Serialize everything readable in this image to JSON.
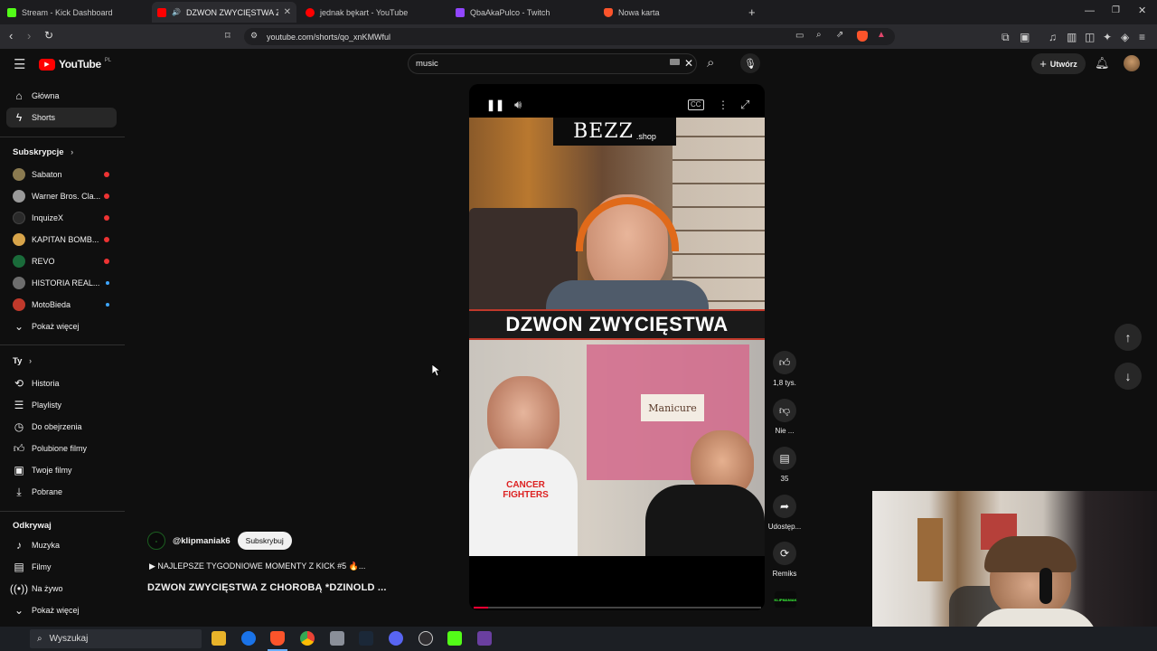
{
  "browser": {
    "tabs": [
      {
        "title": "Stream - Kick Dashboard",
        "icon": "kick-icon",
        "color": "#53fc18"
      },
      {
        "title": "DZWON ZWYCIĘSTWA Z CHO",
        "icon": "youtube-icon",
        "color": "#ff0000",
        "active": true
      },
      {
        "title": "jednak bękart - YouTube",
        "icon": "youtube-icon",
        "color": "#ff0000"
      },
      {
        "title": "QbaAkaPulco - Twitch",
        "icon": "twitch-icon",
        "color": "#9146ff"
      },
      {
        "title": "Nowa karta",
        "icon": "brave-icon",
        "color": "#fb542b"
      }
    ],
    "url": "youtube.com/shorts/qo_xnKMWful"
  },
  "youtube": {
    "logo": "YouTube",
    "logo_region": "PL",
    "search_value": "music",
    "create_label": "Utwórz"
  },
  "sidebar": {
    "main": [
      {
        "label": "Główna",
        "icon": "home-icon"
      },
      {
        "label": "Shorts",
        "icon": "shorts-icon",
        "selected": true
      }
    ],
    "subscriptions_header": "Subskrypcje",
    "subscriptions": [
      {
        "label": "Sabaton",
        "color": "#8a7a50"
      },
      {
        "label": "Warner Bros. Cla...",
        "color": "#9a9a9a"
      },
      {
        "label": "InquizeX",
        "color": "#2a2a2a"
      },
      {
        "label": "KAPITAN BOMB...",
        "color": "#d7a44a"
      },
      {
        "label": "REVO",
        "color": "#1a6b3a"
      },
      {
        "label": "HISTORIA REAL...",
        "color": "#6d6d6d"
      },
      {
        "label": "MotoBieda",
        "color": "#c0392b"
      }
    ],
    "show_more": "Pokaż więcej",
    "you_header": "Ty",
    "you_items": [
      {
        "label": "Historia",
        "icon": "history-icon"
      },
      {
        "label": "Playlisty",
        "icon": "playlists-icon"
      },
      {
        "label": "Do obejrzenia",
        "icon": "watch-later-icon"
      },
      {
        "label": "Polubione filmy",
        "icon": "like-icon"
      },
      {
        "label": "Twoje filmy",
        "icon": "your-videos-icon"
      },
      {
        "label": "Pobrane",
        "icon": "download-icon"
      }
    ],
    "explore_header": "Odkrywaj",
    "explore_items": [
      {
        "label": "Muzyka",
        "icon": "music-icon"
      },
      {
        "label": "Filmy",
        "icon": "movies-icon"
      },
      {
        "label": "Na żywo",
        "icon": "live-icon"
      }
    ],
    "show_more_2": "Pokaż więcej"
  },
  "short": {
    "channel": "@klipmaniak6",
    "subscribe_label": "Subskrybuj",
    "music_line": "▶ NAJLEPSZE TYGODNIOWE MOMENTY Z KICK #5 🔥...",
    "title": "DZWON ZWYCIĘSTWA Z CHOROBĄ *DZINOLD ...",
    "sponsor_logo": "BEZZ",
    "sponsor_suffix": ".shop",
    "caption": "DZWON ZWYCIĘSTWA",
    "shirt_text": "CANCER FIGHTERS",
    "poster_text": "Manicure",
    "progress": 0.05
  },
  "actions": {
    "likes": "1,8 tys.",
    "dislike": "Nie ...",
    "comments": "35",
    "share": "Udostęp...",
    "remix": "Remiks",
    "channel_badge": "KLIPMANIAK"
  },
  "taskbar": {
    "search_placeholder": "Wyszukaj"
  }
}
